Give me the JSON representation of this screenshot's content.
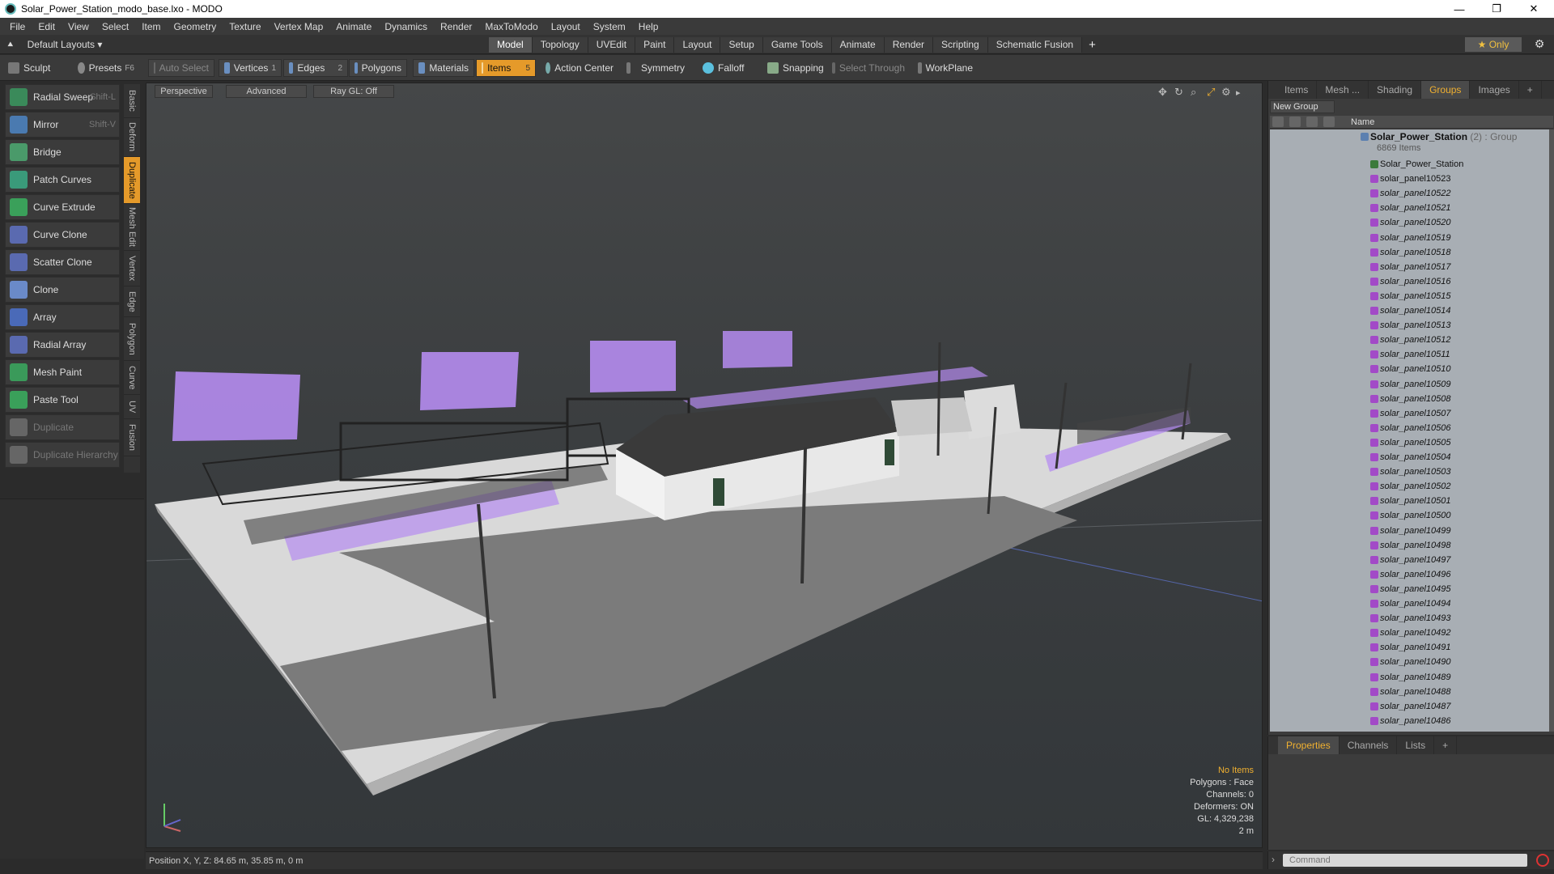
{
  "window": {
    "title": "Solar_Power_Station_modo_base.lxo - MODO"
  },
  "menu": [
    "File",
    "Edit",
    "View",
    "Select",
    "Item",
    "Geometry",
    "Texture",
    "Vertex Map",
    "Animate",
    "Dynamics",
    "Render",
    "MaxToModo",
    "Layout",
    "System",
    "Help"
  ],
  "layout": {
    "selector": "Default Layouts ▾",
    "tabs": [
      "Model",
      "Topology",
      "UVEdit",
      "Paint",
      "Layout",
      "Setup",
      "Game Tools",
      "Animate",
      "Render",
      "Scripting",
      "Schematic Fusion"
    ],
    "active_tab": "Model",
    "only_label": "★ Only"
  },
  "toolbar": {
    "sculpt": "Sculpt",
    "presets": "Presets",
    "presets_key": "F6",
    "auto_select": "Auto Select",
    "vertices": "Vertices",
    "vertices_n": "1",
    "edges": "Edges",
    "edges_n": "2",
    "polygons": "Polygons",
    "materials": "Materials",
    "items": "Items",
    "items_n": "5",
    "action_center": "Action Center",
    "symmetry": "Symmetry",
    "falloff": "Falloff",
    "snapping": "Snapping",
    "select_through": "Select Through",
    "workplane": "WorkPlane"
  },
  "tools": [
    {
      "label": "Radial Sweep",
      "shortcut": "Shift-L"
    },
    {
      "label": "Mirror",
      "shortcut": "Shift-V"
    },
    {
      "label": "Bridge",
      "shortcut": ""
    },
    {
      "label": "Patch Curves",
      "shortcut": ""
    },
    {
      "label": "Curve Extrude",
      "shortcut": ""
    },
    {
      "label": "Curve Clone",
      "shortcut": ""
    },
    {
      "label": "Scatter Clone",
      "shortcut": ""
    },
    {
      "label": "Clone",
      "shortcut": ""
    },
    {
      "label": "Array",
      "shortcut": ""
    },
    {
      "label": "Radial Array",
      "shortcut": ""
    },
    {
      "label": "Mesh Paint",
      "shortcut": ""
    },
    {
      "label": "Paste Tool",
      "shortcut": ""
    },
    {
      "label": "Duplicate",
      "shortcut": ""
    },
    {
      "label": "Duplicate Hierarchy",
      "shortcut": ""
    }
  ],
  "vtabs": [
    "Basic",
    "Deform",
    "Duplicate",
    "Mesh Edit",
    "Vertex",
    "Edge",
    "Polygon",
    "Curve",
    "UV",
    "Fusion"
  ],
  "viewport": {
    "view": "Perspective",
    "mode": "Advanced",
    "raygl": "Ray GL: Off",
    "stats": {
      "selection": "No Items",
      "polygons": "Polygons : Face",
      "channels": "Channels: 0",
      "deformers": "Deformers: ON",
      "gl": "GL: 4,329,238",
      "scale": "2 m"
    }
  },
  "status": {
    "position": "Position X, Y, Z:  84.65 m, 35.85 m, 0 m"
  },
  "right_panel": {
    "tabs": [
      "Items",
      "Mesh ...",
      "Shading",
      "Groups",
      "Images",
      "+"
    ],
    "active_tab": "Groups",
    "new_group": "New Group",
    "column_name": "Name",
    "group": {
      "name": "Solar_Power_Station",
      "count": "(2)",
      "type": ": Group",
      "items": "6869 Items"
    },
    "rows": [
      "Solar_Power_Station",
      "solar_panel10523",
      "solar_panel10522",
      "solar_panel10521",
      "solar_panel10520",
      "solar_panel10519",
      "solar_panel10518",
      "solar_panel10517",
      "solar_panel10516",
      "solar_panel10515",
      "solar_panel10514",
      "solar_panel10513",
      "solar_panel10512",
      "solar_panel10511",
      "solar_panel10510",
      "solar_panel10509",
      "solar_panel10508",
      "solar_panel10507",
      "solar_panel10506",
      "solar_panel10505",
      "solar_panel10504",
      "solar_panel10503",
      "solar_panel10502",
      "solar_panel10501",
      "solar_panel10500",
      "solar_panel10499",
      "solar_panel10498",
      "solar_panel10497",
      "solar_panel10496",
      "solar_panel10495",
      "solar_panel10494",
      "solar_panel10493",
      "solar_panel10492",
      "solar_panel10491",
      "solar_panel10490",
      "solar_panel10489",
      "solar_panel10488",
      "solar_panel10487",
      "solar_panel10486"
    ]
  },
  "prop_panel": {
    "tabs": [
      "Properties",
      "Channels",
      "Lists",
      "+"
    ],
    "active_tab": "Properties"
  },
  "command": {
    "placeholder": "Command"
  },
  "colors": {
    "accent": "#e59a2a",
    "selection": "#b58cf0",
    "list_bg": "#a8aeb4"
  }
}
